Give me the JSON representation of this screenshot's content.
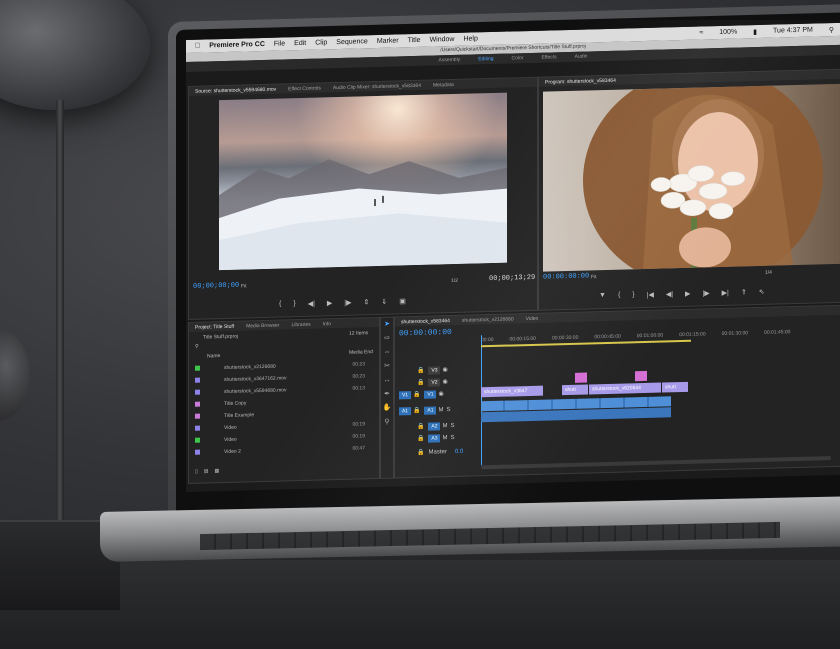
{
  "menubar": {
    "app": "Premiere Pro CC",
    "items": [
      "File",
      "Edit",
      "Clip",
      "Sequence",
      "Marker",
      "Title",
      "Window",
      "Help"
    ],
    "battery": "100%",
    "clock": "Tue 4:37 PM"
  },
  "window_path": "/Users/Quickstart/Documents/Premiere Shortcuts/Title Stuff.prproj",
  "workspaces": [
    "Assembly",
    "Editing",
    "Color",
    "Effects",
    "Audio"
  ],
  "source_monitor": {
    "tabs": [
      "Source: shutterstock_v5594680.mov",
      "Effect Controls",
      "Audio Clip Mixer: shutterstock_v583464",
      "Metadata"
    ],
    "timecode_in": "00;00;00;00",
    "fit": "Fit",
    "resolution": "1/2",
    "timecode_out": "00;00;13;29"
  },
  "program_monitor": {
    "tab": "Program: shutterstock_v583464",
    "timecode": "00:00:00:00",
    "fit": "Fit",
    "resolution": "1/4"
  },
  "project_panel": {
    "tabs": [
      "Project: Title Stuff",
      "Media Browser",
      "Libraries",
      "Info"
    ],
    "file": "Title Stuff.prproj",
    "item_count": "12 Items",
    "col_name": "Name",
    "col_end": "Media End",
    "items": [
      {
        "name": "shutterstock_v2126680",
        "dur": "00:23",
        "color": "#3ec84b"
      },
      {
        "name": "shutterstock_v3647162.mov",
        "dur": "00:23",
        "color": "#8e83e8"
      },
      {
        "name": "shutterstock_v5594680.mov",
        "dur": "00:13",
        "color": "#8e83e8"
      },
      {
        "name": "Title Copy",
        "dur": "",
        "color": "#c97ad8"
      },
      {
        "name": "Title Example",
        "dur": "",
        "color": "#c97ad8"
      },
      {
        "name": "Video",
        "dur": "00:19",
        "color": "#8e83e8"
      },
      {
        "name": "Video",
        "dur": "00:19",
        "color": "#3ec84b"
      },
      {
        "name": "Video 2",
        "dur": "00:47",
        "color": "#8e83e8"
      }
    ]
  },
  "timeline": {
    "tabs": [
      "shutterstock_v583464",
      "shutterstock_v2126680",
      "Video"
    ],
    "timecode": "00:00:00:00",
    "ruler": [
      "00:00",
      "00:00:15:00",
      "00:00:30:00",
      "00:00:45:00",
      "00:01:00:00",
      "00:01:15:00",
      "00:01:30:00",
      "00:01:45:00"
    ],
    "video_tracks": [
      "V3",
      "V2",
      "V1"
    ],
    "audio_tracks": [
      "A1",
      "A2",
      "A3"
    ],
    "source_v": "V1",
    "source_a": "A1",
    "master": "Master",
    "master_val": "0.0",
    "clips": [
      "shutterstock_v3647",
      "shutt",
      "shutterstock_v620844",
      "shutt"
    ],
    "icons_M": "M",
    "icons_S": "S"
  }
}
